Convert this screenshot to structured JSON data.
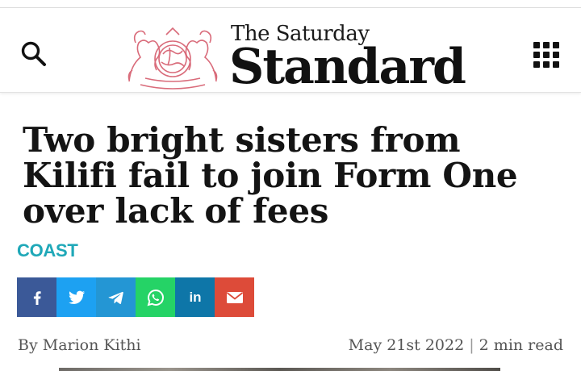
{
  "header": {
    "logo_small": "The Saturday",
    "logo_big": "Standard",
    "search_icon": "search-icon",
    "menu_icon": "grid-menu-icon"
  },
  "article": {
    "headline": "Two bright sisters from Kilifi fail to join Form One over lack of fees",
    "category": "COAST",
    "author": "By Marion Kithi",
    "date": "May 21st 2022",
    "separator": "|",
    "read_time": "2 min read"
  },
  "share": {
    "buttons": [
      {
        "name": "facebook",
        "icon": "facebook-icon",
        "color": "#3b5998"
      },
      {
        "name": "twitter",
        "icon": "twitter-icon",
        "color": "#1da1f2"
      },
      {
        "name": "telegram",
        "icon": "telegram-icon",
        "color": "#2496d4"
      },
      {
        "name": "whatsapp",
        "icon": "whatsapp-icon",
        "color": "#25d366"
      },
      {
        "name": "linkedin",
        "icon": "linkedin-icon",
        "color": "#0e76a8"
      },
      {
        "name": "email",
        "icon": "email-icon",
        "color": "#dd4b39"
      }
    ]
  },
  "colors": {
    "category": "#1fa8b8",
    "crest": "#d96b7a",
    "text": "#141414",
    "meta": "#555555"
  }
}
